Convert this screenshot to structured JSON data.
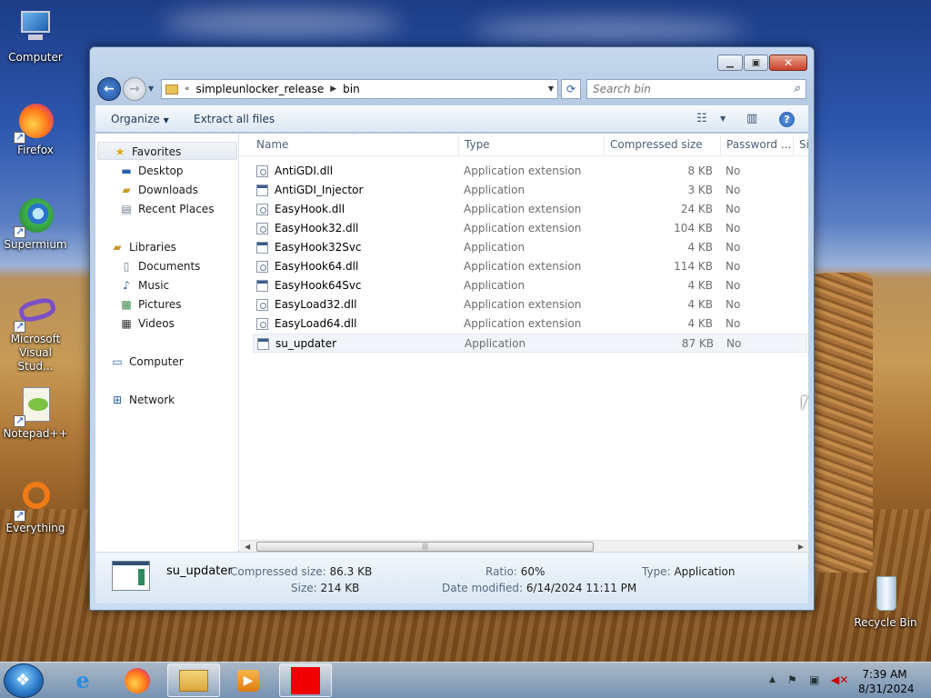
{
  "desktop": {
    "icons": [
      {
        "label": "Computer",
        "icon": "computer-icon"
      },
      {
        "label": "Firefox",
        "icon": "firefox-icon"
      },
      {
        "label": "Supermium",
        "icon": "supermium-icon"
      },
      {
        "label": "Microsoft Visual Stud...",
        "icon": "visual-studio-icon"
      },
      {
        "label": "Notepad++",
        "icon": "notepadpp-icon"
      },
      {
        "label": "Everything",
        "icon": "everything-icon"
      },
      {
        "label": "Recycle Bin",
        "icon": "recycle-bin-icon"
      }
    ]
  },
  "window": {
    "address": {
      "overflow": "«",
      "segments": [
        "simpleunlocker_release",
        "bin"
      ]
    },
    "search": {
      "placeholder": "Search bin"
    },
    "toolbar": {
      "organize": "Organize",
      "extract": "Extract all files"
    },
    "nav": {
      "favorites": "Favorites",
      "desktop": "Desktop",
      "downloads": "Downloads",
      "recent": "Recent Places",
      "libraries": "Libraries",
      "documents": "Documents",
      "music": "Music",
      "pictures": "Pictures",
      "videos": "Videos",
      "computer": "Computer",
      "network": "Network"
    },
    "columns": [
      "Name",
      "Type",
      "Compressed size",
      "Password ...",
      "Si"
    ],
    "files": [
      {
        "name": "AntiGDI.dll",
        "type": "Application extension",
        "size": "8 KB",
        "password": "No",
        "kind": "dll"
      },
      {
        "name": "AntiGDI_Injector",
        "type": "Application",
        "size": "3 KB",
        "password": "No",
        "kind": "app"
      },
      {
        "name": "EasyHook.dll",
        "type": "Application extension",
        "size": "24 KB",
        "password": "No",
        "kind": "dll"
      },
      {
        "name": "EasyHook32.dll",
        "type": "Application extension",
        "size": "104 KB",
        "password": "No",
        "kind": "dll"
      },
      {
        "name": "EasyHook32Svc",
        "type": "Application",
        "size": "4 KB",
        "password": "No",
        "kind": "app"
      },
      {
        "name": "EasyHook64.dll",
        "type": "Application extension",
        "size": "114 KB",
        "password": "No",
        "kind": "dll"
      },
      {
        "name": "EasyHook64Svc",
        "type": "Application",
        "size": "4 KB",
        "password": "No",
        "kind": "app"
      },
      {
        "name": "EasyLoad32.dll",
        "type": "Application extension",
        "size": "4 KB",
        "password": "No",
        "kind": "dll"
      },
      {
        "name": "EasyLoad64.dll",
        "type": "Application extension",
        "size": "4 KB",
        "password": "No",
        "kind": "dll"
      },
      {
        "name": "su_updater",
        "type": "Application",
        "size": "87 KB",
        "password": "No",
        "kind": "app",
        "selected": true
      }
    ],
    "details": {
      "name": "su_updater",
      "compressed_label": "Compressed size:",
      "compressed_value": "86.3 KB",
      "size_label": "Size:",
      "size_value": "214 KB",
      "ratio_label": "Ratio:",
      "ratio_value": "60%",
      "modified_label": "Date modified:",
      "modified_value": "6/14/2024 11:11 PM",
      "type_label": "Type:",
      "type_value": "Application"
    }
  },
  "taskbar": {
    "apps": [
      "internet-explorer-icon",
      "firefox-icon",
      "file-explorer-icon",
      "media-player-icon",
      "red-app-icon"
    ],
    "time": "7:39 AM",
    "date": "8/31/2024"
  }
}
